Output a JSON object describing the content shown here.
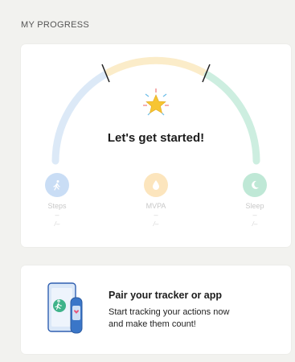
{
  "section": {
    "title": "MY PROGRESS"
  },
  "progress": {
    "headline": "Let's get started!",
    "metrics": [
      {
        "name": "Steps",
        "value": "–",
        "goal": "/–",
        "color": "#b9d3f3",
        "icon": "walking-person-icon"
      },
      {
        "name": "MVPA",
        "value": "–",
        "goal": "/–",
        "color": "#fbe1b0",
        "icon": "activity-drop-icon"
      },
      {
        "name": "Sleep",
        "value": "–",
        "goal": "/–",
        "color": "#b8e6d2",
        "icon": "moon-sleep-icon"
      }
    ],
    "arc_colors": {
      "left": "#dce9f7",
      "middle": "#fbecc9",
      "right": "#cdeee0"
    },
    "star_color": "#f7c532"
  },
  "pair": {
    "title": "Pair your tracker or app",
    "subtitle_line1": "Start tracking your actions now",
    "subtitle_line2": "and make them count!",
    "illustration": "phone-and-band-icon"
  }
}
